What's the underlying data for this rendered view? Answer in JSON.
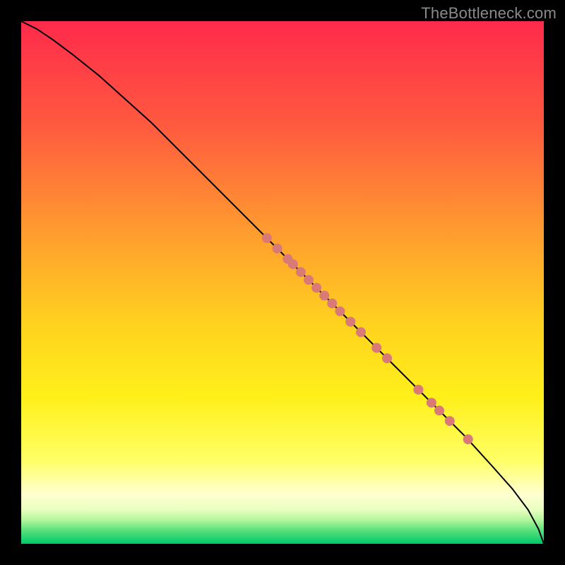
{
  "watermark": "TheBottleneck.com",
  "chart_data": {
    "type": "line",
    "title": "",
    "xlabel": "",
    "ylabel": "",
    "xlim": [
      0,
      100
    ],
    "ylim": [
      0,
      100
    ],
    "grid": false,
    "legend": false,
    "background_gradient": {
      "stops": [
        {
          "offset": 0.0,
          "color": "#ff2a4b"
        },
        {
          "offset": 0.2,
          "color": "#ff5a3f"
        },
        {
          "offset": 0.4,
          "color": "#ff9b2f"
        },
        {
          "offset": 0.58,
          "color": "#ffd21f"
        },
        {
          "offset": 0.72,
          "color": "#fff01a"
        },
        {
          "offset": 0.84,
          "color": "#ffff66"
        },
        {
          "offset": 0.905,
          "color": "#ffffd0"
        },
        {
          "offset": 0.935,
          "color": "#e8ffc0"
        },
        {
          "offset": 0.955,
          "color": "#b0f59a"
        },
        {
          "offset": 0.975,
          "color": "#55e07a"
        },
        {
          "offset": 1.0,
          "color": "#00c86a"
        }
      ]
    },
    "series": [
      {
        "name": "curve",
        "type": "line",
        "color": "#000000",
        "width": 2,
        "x": [
          0,
          3,
          6,
          10,
          15,
          20,
          25,
          30,
          35,
          40,
          45,
          50,
          55,
          60,
          65,
          70,
          75,
          80,
          85,
          90,
          94,
          97,
          99,
          100
        ],
        "y": [
          100,
          98.5,
          96.5,
          93.5,
          89.5,
          85,
          80.5,
          75.5,
          70.5,
          65.5,
          60.5,
          55.5,
          50.5,
          45.5,
          40.5,
          35.5,
          30.5,
          25.5,
          20.5,
          15,
          10.5,
          6.5,
          2.8,
          0
        ]
      },
      {
        "name": "points",
        "type": "scatter",
        "color": "#d97a77",
        "radius": 7,
        "x": [
          47,
          49,
          51,
          52,
          53.5,
          55,
          56.5,
          58,
          59.5,
          61,
          63,
          65,
          68,
          70,
          76,
          78.5,
          80,
          82,
          85.5
        ],
        "y": [
          58.5,
          56.5,
          54.5,
          53.5,
          52,
          50.5,
          49,
          47.5,
          46,
          44.5,
          42.5,
          40.5,
          37.5,
          35.5,
          29.5,
          27,
          25.5,
          23.5,
          20
        ]
      }
    ]
  }
}
